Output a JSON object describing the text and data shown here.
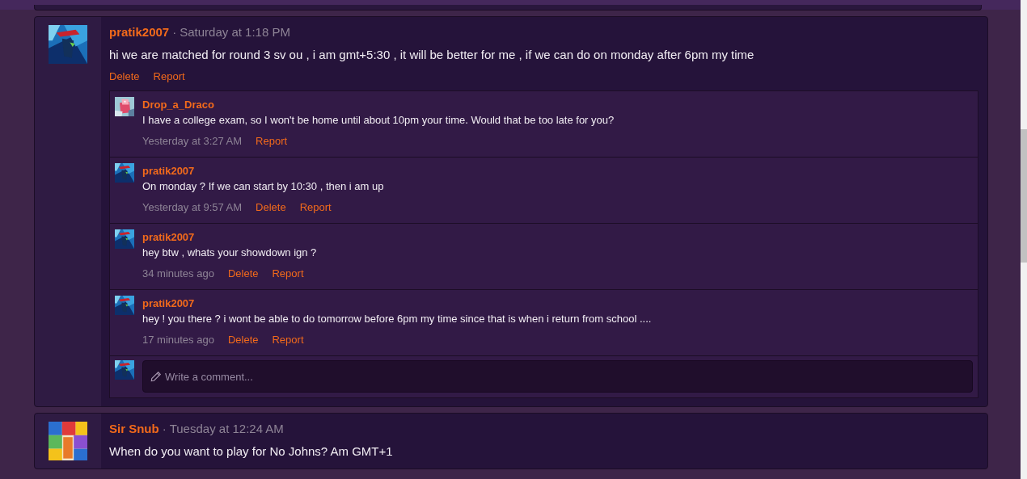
{
  "posts": [
    {
      "author": "pratik2007",
      "separator": "·",
      "time": "Saturday at 1:18 PM",
      "text": "hi we are matched for round 3 sv ou , i am gmt+5:30 , it will be better for me , if we can do on monday after 6pm my time",
      "actions": [
        "Delete",
        "Report"
      ],
      "comments": [
        {
          "author": "Drop_a_Draco",
          "text": "I have a college exam, so I won't be home until about 10pm your time. Would that be too late for you?",
          "time": "Yesterday at 3:27 AM",
          "actions": [
            "Report"
          ]
        },
        {
          "author": "pratik2007",
          "text": "On monday ? If we can start by 10:30 , then i am up",
          "time": "Yesterday at 9:57 AM",
          "actions": [
            "Delete",
            "Report"
          ]
        },
        {
          "author": "pratik2007",
          "text": "hey btw , whats your showdown ign ?",
          "time": "34 minutes ago",
          "actions": [
            "Delete",
            "Report"
          ]
        },
        {
          "author": "pratik2007",
          "text": "hey ! you there ? i wont be able to do tomorrow before 6pm my time since that is when i return from school ....",
          "time": "17 minutes ago",
          "actions": [
            "Delete",
            "Report"
          ]
        }
      ],
      "comment_field": {
        "placeholder": "Write a comment..."
      }
    },
    {
      "author": "Sir Snub",
      "separator": "·",
      "time": "Tuesday at 12:24 AM",
      "text": "When do you want to play for No Johns? Am GMT+1"
    }
  ]
}
